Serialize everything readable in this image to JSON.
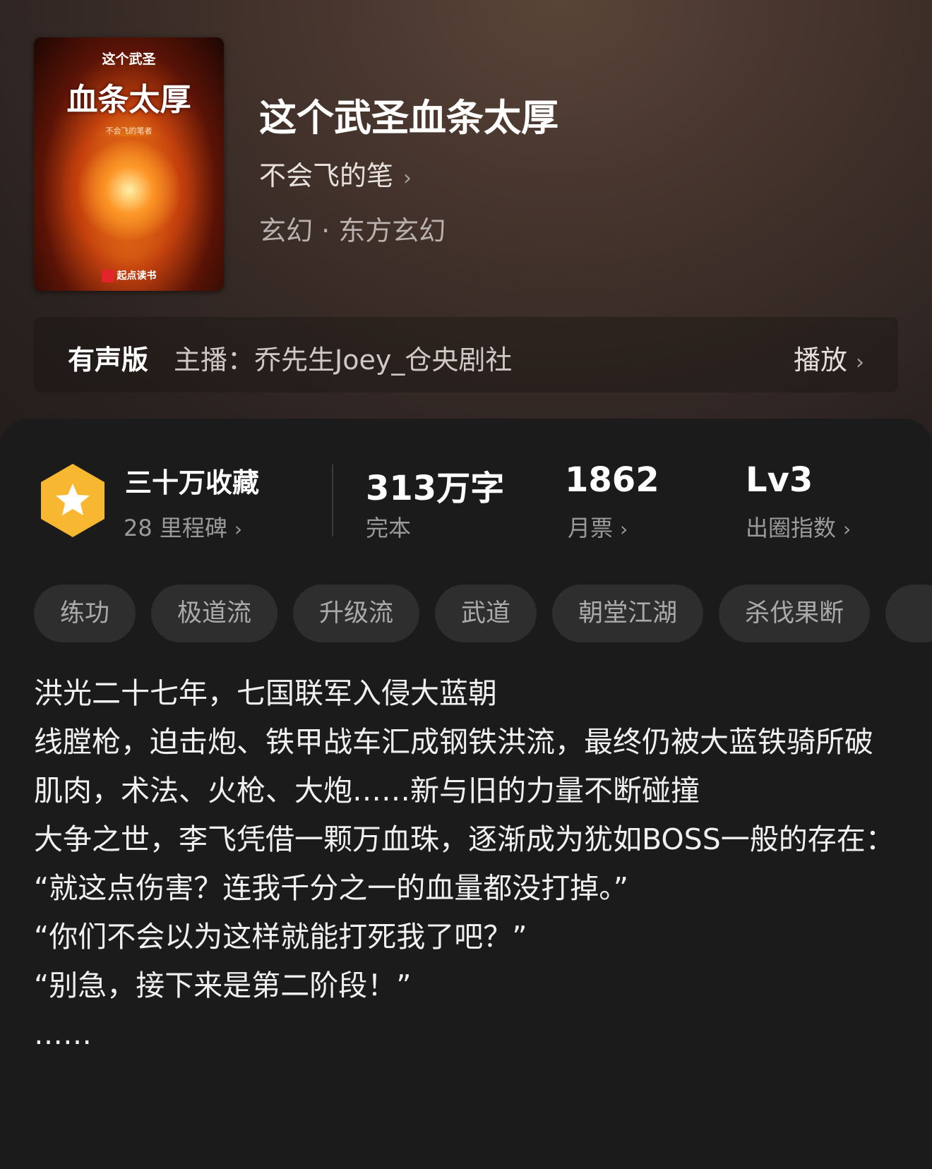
{
  "book": {
    "cover": {
      "small_title": "这个武圣",
      "big_title": "血条太厚",
      "author": "不会飞的笔者",
      "publisher": "起点读书"
    },
    "title": "这个武圣血条太厚",
    "author": "不会飞的笔",
    "genre": "玄幻 · 东方玄幻"
  },
  "audio": {
    "tag": "有声版",
    "host": "主播：乔先生Joey_仓央剧社",
    "play_label": "播放"
  },
  "stats": {
    "favorites": {
      "label": "三十万收藏",
      "sub": "28 里程碑"
    },
    "words": {
      "value": "313万字",
      "sub": "完本"
    },
    "monthly": {
      "value": "1862",
      "sub": "月票"
    },
    "level": {
      "value": "Lv3",
      "sub": "出圈指数"
    }
  },
  "tags": [
    "练功",
    "极道流",
    "升级流",
    "武道",
    "朝堂江湖",
    "杀伐果断"
  ],
  "synopsis": [
    "洪光二十七年，七国联军入侵大蓝朝",
    "线膛枪，迫击炮、铁甲战车汇成钢铁洪流，最终仍被大蓝铁骑所破",
    "肌肉，术法、火枪、大炮……新与旧的力量不断碰撞",
    "大争之世，李飞凭借一颗万血珠，逐渐成为犹如BOSS一般的存在：",
    "“就这点伤害？连我千分之一的血量都没打掉。”",
    "“你们不会以为这样就能打死我了吧？”",
    "“别急，接下来是第二阶段！”",
    "……"
  ],
  "colors": {
    "badge": "#f7b731",
    "background": "#1b1b1b",
    "tag_bg": "#2e2e2e"
  }
}
